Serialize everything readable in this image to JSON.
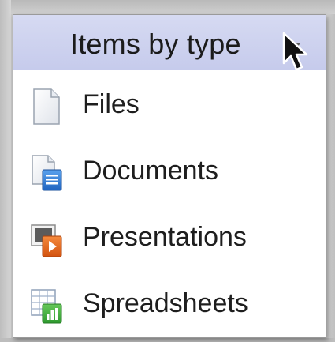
{
  "menu": {
    "title": "Items by type",
    "caret_icon": "chevron-down-icon",
    "items": [
      {
        "label": "Files",
        "icon": "file-icon"
      },
      {
        "label": "Documents",
        "icon": "document-icon"
      },
      {
        "label": "Presentations",
        "icon": "presentation-icon"
      },
      {
        "label": "Spreadsheets",
        "icon": "spreadsheet-icon"
      }
    ]
  },
  "colors": {
    "header_bg": "#ccd1ee",
    "document_blue": "#2d7bd6",
    "presentation_orange": "#e8641f",
    "spreadsheet_green": "#3fae3f"
  }
}
